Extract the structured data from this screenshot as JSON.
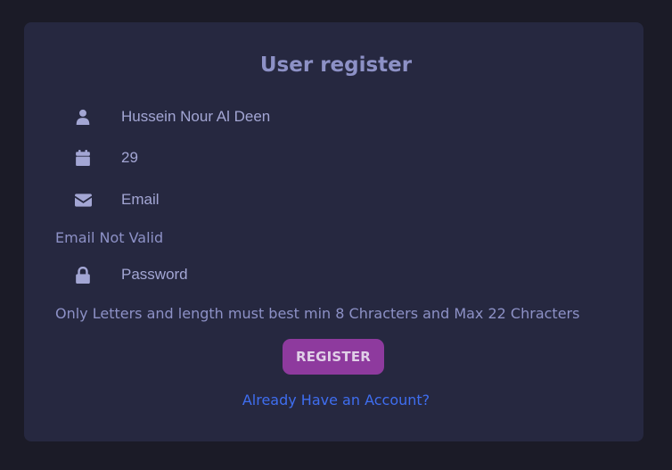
{
  "form": {
    "title": "User register",
    "name": {
      "value": "Hussein Nour Al Deen",
      "icon": "user-icon"
    },
    "age": {
      "value": "29",
      "icon": "calendar-icon"
    },
    "email": {
      "value": "",
      "placeholder": "Email",
      "icon": "envelope-icon",
      "error": "Email Not Valid"
    },
    "password": {
      "value": "",
      "placeholder": "Password",
      "icon": "lock-icon",
      "error": "Only Letters and length must best min 8 Chracters and Max 22 Chracters"
    },
    "register_label": "REGISTER",
    "login_link": "Already Have an Account?"
  },
  "colors": {
    "page_background": "#1b1b27",
    "card_background": "#262840",
    "text": "#8d91c6",
    "button": "#8e3a9e",
    "link": "#3f6ef0"
  }
}
